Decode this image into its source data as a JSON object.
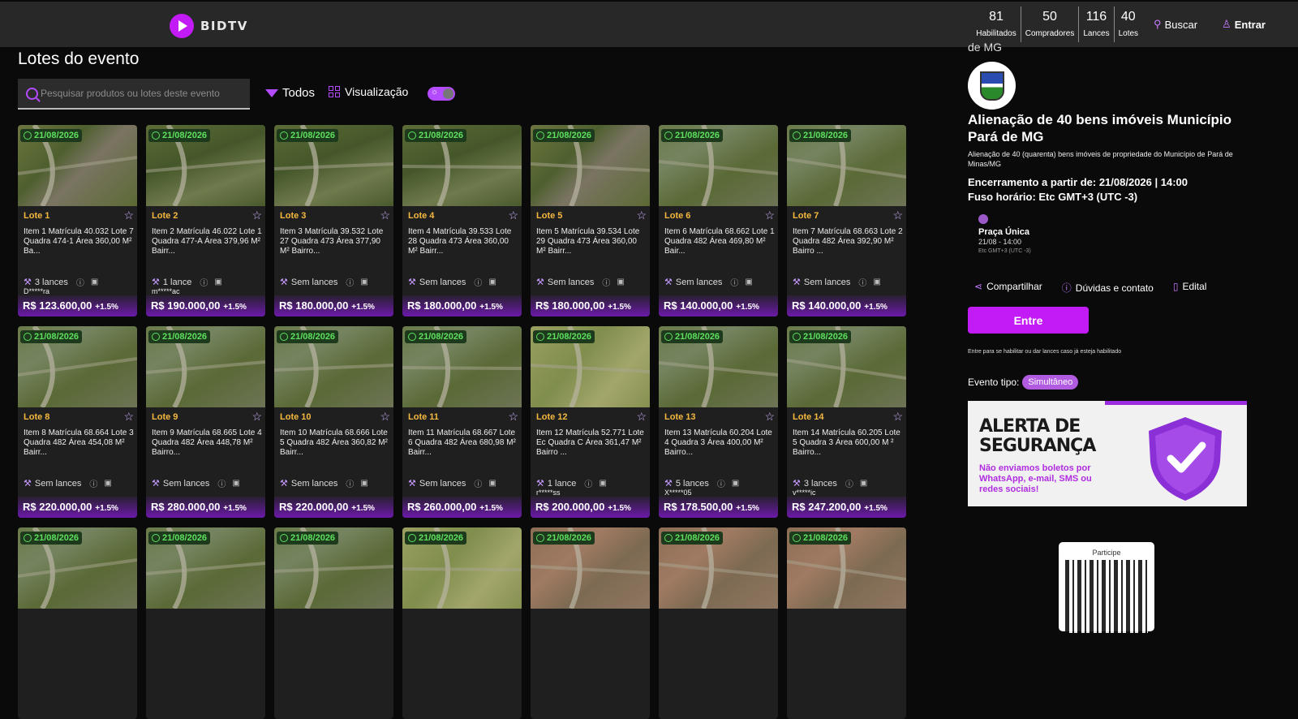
{
  "header": {
    "brand": "BIDTV",
    "stats": [
      {
        "value": "81",
        "label": "Habilitados"
      },
      {
        "value": "50",
        "label": "Compradores"
      },
      {
        "value": "116",
        "label": "Lances"
      },
      {
        "value": "40",
        "label": "Lotes"
      }
    ],
    "search_label": "Buscar",
    "login_label": "Entrar"
  },
  "main": {
    "title": "Lotes do evento",
    "search_placeholder": "Pesquisar produtos ou lotes deste evento",
    "filter_label": "Todos",
    "view_label": "Visualização",
    "lots": [
      {
        "date": "21/08/2026",
        "lote": "Lote 1",
        "desc": "Item 1 Matrícula 40.032 Lote 7 Quadra 474-1 Área 360,00 M² Ba...",
        "bids": "3 lances",
        "bidder": "D*****ra",
        "price": "R$ 123.600,00",
        "pct": "+1.5%"
      },
      {
        "date": "21/08/2026",
        "lote": "Lote 2",
        "desc": "Item 2 Matrícula 46.022 Lote 1 Quadra 477-A Área 379,96 M² Bairr...",
        "bids": "1 lance",
        "bidder": "m*****ac",
        "price": "R$ 190.000,00",
        "pct": "+1.5%"
      },
      {
        "date": "21/08/2026",
        "lote": "Lote 3",
        "desc": "Item 3 Matrícula 39.532 Lote 27 Quadra 473 Área 377,90 M² Bairro...",
        "bids": "Sem lances",
        "bidder": "",
        "price": "R$ 180.000,00",
        "pct": "+1.5%"
      },
      {
        "date": "21/08/2026",
        "lote": "Lote 4",
        "desc": "Item 4 Matrícula 39.533 Lote 28 Quadra 473 Área 360,00 M² Bairr...",
        "bids": "Sem lances",
        "bidder": "",
        "price": "R$ 180.000,00",
        "pct": "+1.5%"
      },
      {
        "date": "21/08/2026",
        "lote": "Lote 5",
        "desc": "Item 5 Matrícula 39.534 Lote 29 Quadra 473 Área 360,00 M² Bairr...",
        "bids": "Sem lances",
        "bidder": "",
        "price": "R$ 180.000,00",
        "pct": "+1.5%"
      },
      {
        "date": "21/08/2026",
        "lote": "Lote 6",
        "desc": "Item 6 Matrícula 68.662 Lote 1 Quadra 482 Área 469,80 M² Bair...",
        "bids": "Sem lances",
        "bidder": "",
        "price": "R$ 140.000,00",
        "pct": "+1.5%"
      },
      {
        "date": "21/08/2026",
        "lote": "Lote 7",
        "desc": "Item 7 Matrícula 68.663 Lote 2 Quadra 482 Área 392,90 M² Bairro ...",
        "bids": "Sem lances",
        "bidder": "",
        "price": "R$ 140.000,00",
        "pct": "+1.5%"
      },
      {
        "date": "21/08/2026",
        "lote": "Lote 8",
        "desc": "Item 8 Matrícula 68.664 Lote 3 Quadra 482 Área 454,08 M² Bairr...",
        "bids": "Sem lances",
        "bidder": "",
        "price": "R$ 220.000,00",
        "pct": "+1.5%"
      },
      {
        "date": "21/08/2026",
        "lote": "Lote 9",
        "desc": "Item 9 Matrícula 68.665 Lote 4 Quadra 482 Área 448,78 M² Bairro...",
        "bids": "Sem lances",
        "bidder": "",
        "price": "R$ 280.000,00",
        "pct": "+1.5%"
      },
      {
        "date": "21/08/2026",
        "lote": "Lote 10",
        "desc": "Item 10 Matrícula 68.666 Lote 5 Quadra 482 Área 360,82 M² Bairr...",
        "bids": "Sem lances",
        "bidder": "",
        "price": "R$ 220.000,00",
        "pct": "+1.5%"
      },
      {
        "date": "21/08/2026",
        "lote": "Lote 11",
        "desc": "Item 11 Matrícula 68.667 Lote 6 Quadra 482 Área 680,98 M² Bairr...",
        "bids": "Sem lances",
        "bidder": "",
        "price": "R$ 260.000,00",
        "pct": "+1.5%"
      },
      {
        "date": "21/08/2026",
        "lote": "Lote 12",
        "desc": "Item 12 Matrícula 52.771 Lote Ec Quadra C Área 361,47 M² Bairro ...",
        "bids": "1 lance",
        "bidder": "r*****ss",
        "price": "R$ 200.000,00",
        "pct": "+1.5%"
      },
      {
        "date": "21/08/2026",
        "lote": "Lote 13",
        "desc": "Item 13 Matrícula 60.204 Lote 4 Quadra 3 Área 400,00 M² Bairro...",
        "bids": "5 lances",
        "bidder": "X*****05",
        "price": "R$ 178.500,00",
        "pct": "+1.5%"
      },
      {
        "date": "21/08/2026",
        "lote": "Lote 14",
        "desc": "Item 14 Matrícula 60.205 Lote 5 Quadra 3 Área 600,00 M ² Bairro...",
        "bids": "3 lances",
        "bidder": "v*****ic",
        "price": "R$ 247.200,00",
        "pct": "+1.5%"
      },
      {
        "date": "21/08/2026"
      },
      {
        "date": "21/08/2026"
      },
      {
        "date": "21/08/2026"
      },
      {
        "date": "21/08/2026"
      },
      {
        "date": "21/08/2026"
      },
      {
        "date": "21/08/2026"
      },
      {
        "date": "21/08/2026"
      }
    ]
  },
  "side": {
    "cutoff_text": "de MG",
    "title": "Alienação de 40 bens imóveis Município Pará de MG",
    "subtitle": "Alienação de 40 (quarenta) bens imóveis de propriedade do Município de Pará de Minas/MG",
    "end_line": "Encerramento a partir de: 21/08/2026 | 14:00",
    "tz_line": "Fuso horário: Etc GMT+3 (UTC -3)",
    "phase_name": "Praça Única",
    "phase_dates": "21/08 - 14:00",
    "phase_tz": "Etc GMT+3 (UTC -3)",
    "share": "Compartilhar",
    "help": "Dúvidas e contato",
    "edital": "Edital",
    "enter": "Entre",
    "hint": "Entre para se habilitar ou dar lances caso já esteja habilitado",
    "event_type_label": "Evento tipo:",
    "event_type": "Simultâneo",
    "banner_title_1": "ALERTA DE",
    "banner_title_2": "SEGURANÇA",
    "banner_text": "Não enviamos boletos por WhatsApp, e-mail, SMS ou redes sociais!",
    "qr_label": "Participe"
  }
}
